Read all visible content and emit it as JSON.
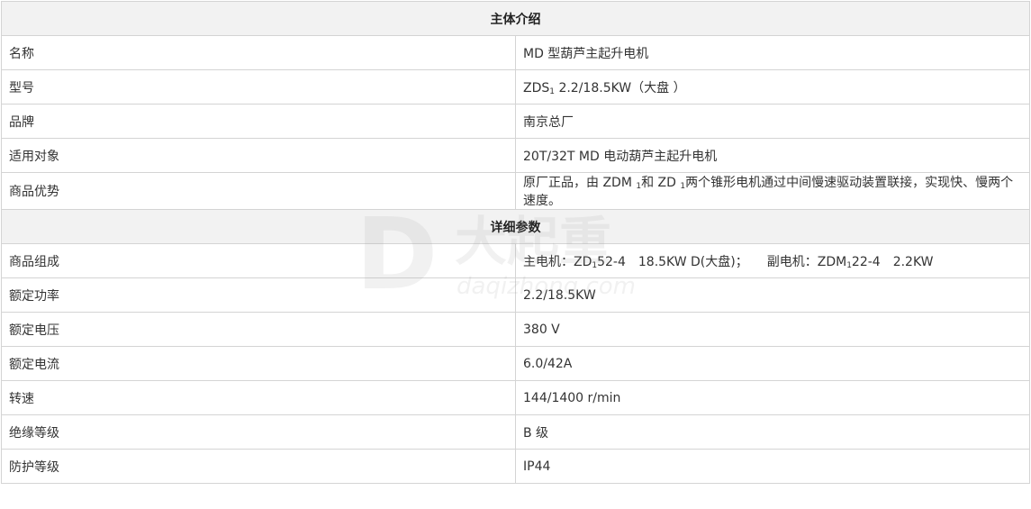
{
  "sections": [
    {
      "title": "主体介绍",
      "rows": [
        {
          "label": "名称",
          "value": "MD 型葫芦主起升电机"
        },
        {
          "label": "型号",
          "value_parts": [
            "ZDS",
            "1",
            " 2.2/18.5KW（大盘 ）"
          ]
        },
        {
          "label": "品牌",
          "value": "南京总厂"
        },
        {
          "label": "适用对象",
          "value": "20T/32T MD 电动葫芦主起升电机"
        },
        {
          "label": "商品优势",
          "value_parts": [
            "原厂正品，由 ZDM ",
            "1",
            "和 ZD ",
            "1",
            "两个锥形电机通过中间慢速驱动装置联接，实现快、慢两个速度。"
          ]
        }
      ]
    },
    {
      "title": "详细参数",
      "rows": [
        {
          "label": "商品组成",
          "value_parts": [
            "主电机：ZD",
            "1",
            "52-4　18.5KW D(大盘)；　　副电机：ZDM",
            "1",
            "22-4　2.2KW"
          ]
        },
        {
          "label": "额定功率",
          "value": "2.2/18.5KW"
        },
        {
          "label": "额定电压",
          "value": "380 V"
        },
        {
          "label": "额定电流",
          "value": "6.0/42A"
        },
        {
          "label": "转速",
          "value": "144/1400 r/min"
        },
        {
          "label": "绝缘等级",
          "value": "B 级"
        },
        {
          "label": "防护等级",
          "value": "IP44"
        }
      ]
    }
  ],
  "watermark": {
    "brand": "大起重",
    "domain": "daqizhong.com"
  }
}
